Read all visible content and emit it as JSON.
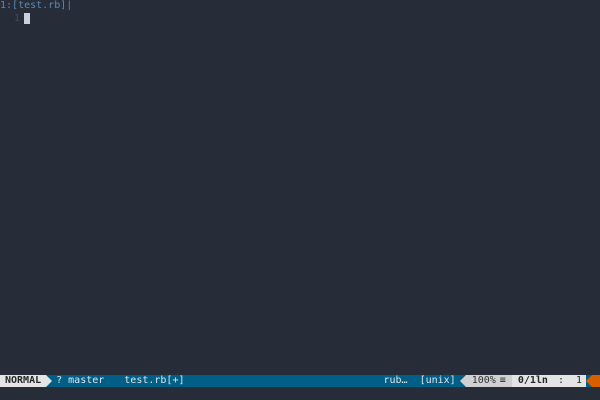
{
  "tabline": {
    "tab_number": "1:",
    "tab_label": "[test.rb]",
    "tab_end": "|"
  },
  "editor": {
    "lines": [
      {
        "number": "1",
        "text": ""
      }
    ]
  },
  "statusline": {
    "mode": "NORMAL",
    "branch_icon": "?",
    "branch": "master",
    "filename": "test.rb[+]",
    "filetype": "rub…",
    "fileformat": "[unix]",
    "percent": "100%",
    "percent_icon": "≡",
    "line_info": "0/1ln",
    "col_sep": ":",
    "col": "1"
  },
  "colors": {
    "background": "#262d38",
    "statusline_accent": "#005f87",
    "mode_bg": "#e4e4e4",
    "warning": "#d75f00"
  }
}
